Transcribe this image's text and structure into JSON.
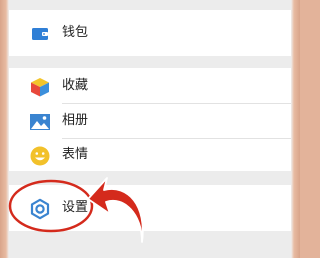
{
  "menu": {
    "wallet_label": "钱包",
    "favorites_label": "收藏",
    "album_label": "相册",
    "stickers_label": "表情",
    "settings_label": "设置"
  },
  "colors": {
    "wallet_icon": "#2f7fd6",
    "accent_blue": "#3a84d0",
    "emoji_yellow": "#f2c12a",
    "annotation_red": "#d42a1c"
  },
  "icons": {
    "wallet": "wallet-icon",
    "favorites": "favorites-cube-icon",
    "album": "album-mountain-icon",
    "stickers": "smiley-icon",
    "settings": "gear-icon"
  }
}
